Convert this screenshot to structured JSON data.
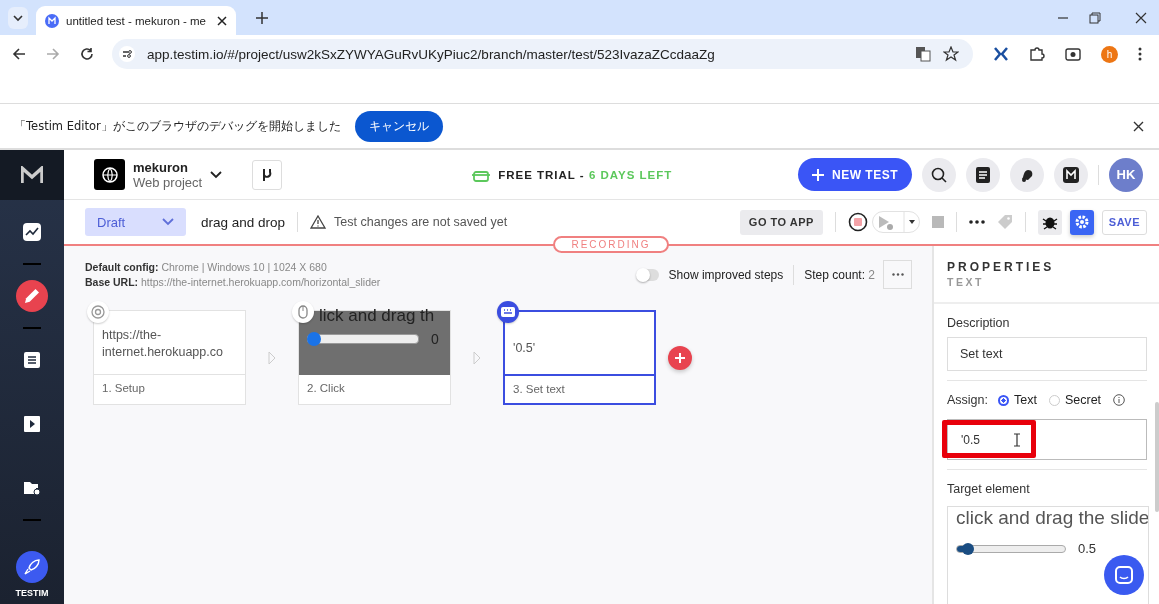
{
  "browser": {
    "tab_title": "untitled test - mekuron - me",
    "url": "app.testim.io/#/project/usw2kSxZYWYAGuRvUKyPiuc2/branch/master/test/523IvazaZCcdaaZg",
    "profile": "h"
  },
  "infobar": {
    "message": "「Testim Editor」がこのブラウザのデバッグを開始しました",
    "button": "キャンセル"
  },
  "sidebar": {
    "items": [
      {
        "selected": false
      },
      {
        "selected": true
      },
      {
        "selected": false
      },
      {
        "selected": false
      },
      {
        "selected": false
      }
    ],
    "brand_label": "TESTIM"
  },
  "header": {
    "project_name": "mekuron",
    "project_type": "Web project",
    "trial_label": "FREE TRIAL - ",
    "trial_days": "6 DAYS LEFT",
    "new_test": "NEW TEST",
    "avatar": "HK"
  },
  "toolbar": {
    "status": "Draft",
    "test_name": "drag and drop",
    "warning": "Test changes are not saved yet",
    "go_to_app": "GO TO APP",
    "save": "SAVE",
    "recording": "RECORDING"
  },
  "config": {
    "default_label": "Default config:",
    "default_value": "Chrome | Windows 10 | 1024 X 680",
    "base_label": "Base URL:",
    "base_value": "https://the-internet.herokuapp.com/horizontal_slider",
    "toggle_label": "Show improved steps",
    "toggle_on": false,
    "step_count_label": "Step count:",
    "step_count": "2"
  },
  "steps": [
    {
      "kind": "url",
      "text": "https://the-internet.herokuapp.co",
      "label": "1. Setup",
      "selected": false
    },
    {
      "kind": "screenshot",
      "heading": "lick and drag th",
      "level": 0,
      "value": "0",
      "label": "2. Click",
      "selected": false
    },
    {
      "kind": "text",
      "text": "'0.5'",
      "label": "3. Set text",
      "selected": true
    }
  ],
  "properties": {
    "title": "PROPERTIES",
    "subtitle": "TEXT",
    "description_label": "Description",
    "description": "Set text",
    "assign_label": "Assign:",
    "assign_options": [
      {
        "label": "Text",
        "selected": true
      },
      {
        "label": "Secret",
        "selected": false
      }
    ],
    "value": "'0.5",
    "target_label": "Target element",
    "target_heading": "click and drag the slide",
    "target_slider": {
      "level": 0.1
    },
    "target_value": "0.5"
  }
}
